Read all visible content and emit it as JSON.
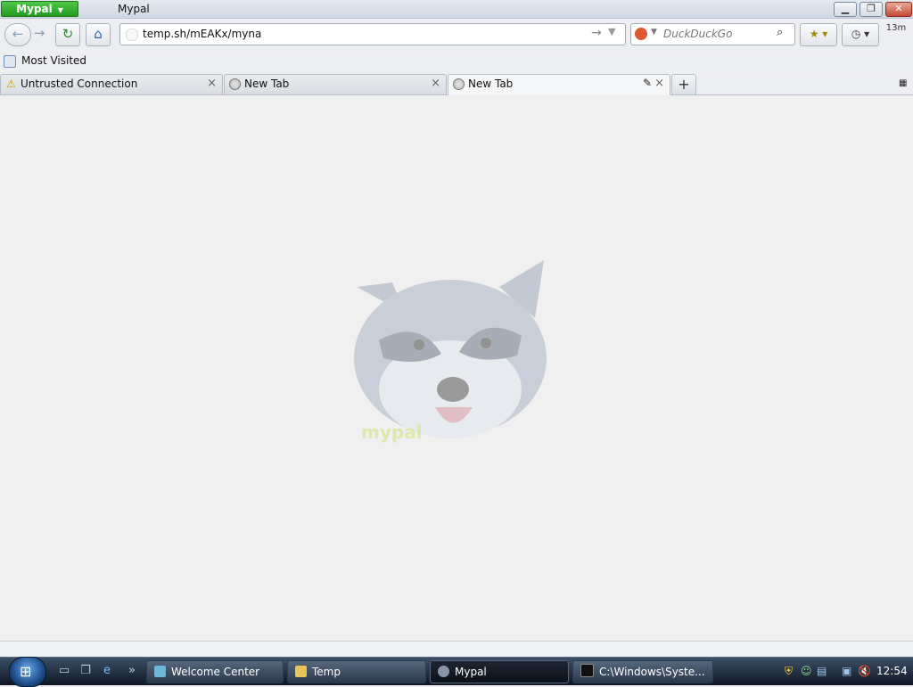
{
  "window": {
    "app_button": "Mypal",
    "title": "Mypal",
    "controls": [
      "minimize",
      "restore",
      "close"
    ]
  },
  "navbar": {
    "url_value": "temp.sh/mEAKx/myna",
    "search_placeholder": "DuckDuckGo",
    "history_badge": "13m"
  },
  "bookmarks": {
    "items": [
      {
        "label": "Most Visited"
      }
    ]
  },
  "tabs": [
    {
      "label": "Untrusted Connection",
      "icon": "warning-icon",
      "active": false
    },
    {
      "label": "New Tab",
      "icon": "globe-icon",
      "active": false
    },
    {
      "label": "New Tab",
      "icon": "globe-icon",
      "active": true
    }
  ],
  "content": {
    "logo_text": "mypal"
  },
  "taskbar": {
    "tasks": [
      {
        "label": "Welcome Center",
        "active": false
      },
      {
        "label": "Temp",
        "active": false
      },
      {
        "label": "Mypal",
        "active": true
      },
      {
        "label": "C:\\Windows\\Syste...",
        "active": false
      }
    ],
    "clock": "12:54"
  },
  "colors": {
    "app_button": "#2fae2d",
    "background": "#f0f0f0",
    "taskbar": "#1a2636"
  }
}
